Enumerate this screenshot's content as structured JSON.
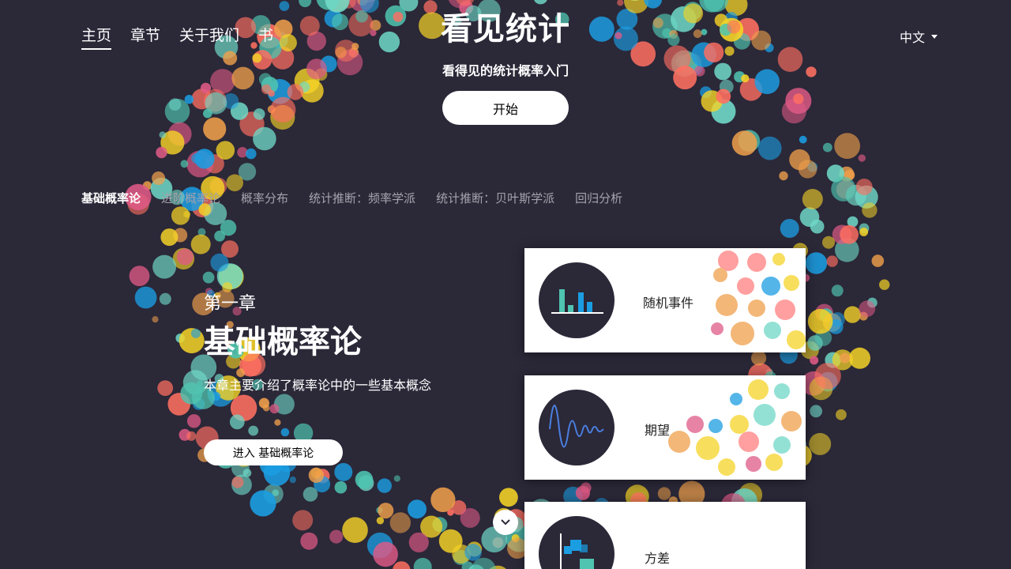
{
  "nav": {
    "items": [
      {
        "label": "主页",
        "active": true
      },
      {
        "label": "章节",
        "active": false
      },
      {
        "label": "关于我们",
        "active": false
      },
      {
        "label": "书",
        "active": false
      }
    ]
  },
  "language": {
    "label": "中文",
    "icon": "caret-down-icon"
  },
  "hero": {
    "title": "看见统计",
    "subtitle": "看得见的统计概率入门",
    "start_label": "开始"
  },
  "chapter_tabs": [
    {
      "label": "基础概率论",
      "active": true
    },
    {
      "label": "进阶概率论",
      "active": false
    },
    {
      "label": "概率分布",
      "active": false
    },
    {
      "label": "统计推断：频率学派",
      "active": false
    },
    {
      "label": "统计推断：贝叶斯学派",
      "active": false
    },
    {
      "label": "回归分析",
      "active": false
    }
  ],
  "chapter": {
    "number": "第一章",
    "title": "基础概率论",
    "description": "本章主要介绍了概率论中的一些基本概念",
    "enter_label": "进入 基础概率论"
  },
  "cards": [
    {
      "label": "随机事件",
      "icon": "bar-chart-icon"
    },
    {
      "label": "期望",
      "icon": "wave-icon"
    },
    {
      "label": "方差",
      "icon": "variance-icon"
    }
  ],
  "scroll": {
    "icon": "chevron-down-icon"
  },
  "colors": {
    "background": "#2b2838",
    "dots": [
      "#e05a86",
      "#f0a04b",
      "#4fc4b0",
      "#1b9de2",
      "#f5d327",
      "#ff6f61",
      "#6fd8c7"
    ]
  }
}
